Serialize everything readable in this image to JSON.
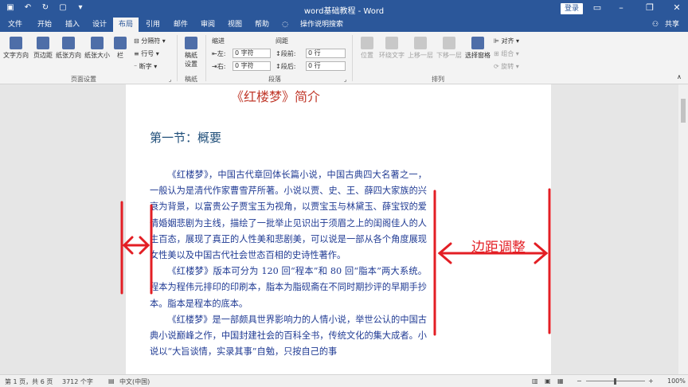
{
  "window": {
    "title": "word基础教程 - Word",
    "login_label": "登录"
  },
  "tabs": [
    {
      "label": "文件"
    },
    {
      "label": "开始"
    },
    {
      "label": "插入"
    },
    {
      "label": "设计"
    },
    {
      "label": "布局"
    },
    {
      "label": "引用"
    },
    {
      "label": "邮件"
    },
    {
      "label": "审阅"
    },
    {
      "label": "视图"
    },
    {
      "label": "帮助"
    },
    {
      "label": "操作说明搜索"
    }
  ],
  "share_label": "共享",
  "ribbon": {
    "page_setup": {
      "group_label": "页面设置",
      "text_direction": "文字方向",
      "margins": "页边距",
      "orientation": "纸张方向",
      "size": "纸张大小",
      "columns": "栏",
      "breaks": "分隔符",
      "line_numbers": "行号",
      "hyphenation": "断字"
    },
    "draft": {
      "group_label": "稿纸",
      "draft_setup": "稿纸\n设置"
    },
    "paragraph": {
      "group_label": "段落",
      "indent_label": "缩进",
      "spacing_label": "间距",
      "left_label": "左:",
      "left_value": "0 字符",
      "right_label": "右:",
      "right_value": "0 字符",
      "before_label": "段前:",
      "before_value": "0 行",
      "after_label": "段后:",
      "after_value": "0 行"
    },
    "arrange": {
      "group_label": "排列",
      "position": "位置",
      "wrap_text": "环绕文字",
      "bring_forward": "上移一层",
      "send_backward": "下移一层",
      "selection_pane": "选择窗格",
      "align": "对齐",
      "group": "组合",
      "rotate": "旋转"
    }
  },
  "document": {
    "title": "《红楼梦》简介",
    "section_heading": "第一节：概要",
    "paragraphs": [
      "《红楼梦》，中国古代章回体长篇小说，中国古典四大名著之一，一般认为是清代作家曹雪芹所著。小说以贾、史、王、薛四大家族的兴衰为背景，以富贵公子贾宝玉为视角，以贾宝玉与林黛玉、薛宝钗的爱情婚姻悲剧为主线，描绘了一批举止见识出于须眉之上的闺阁佳人的人生百态，展现了真正的人性美和悲剧美，可以说是一部从各个角度展现女性美以及中国古代社会世态百相的史诗性著作。",
      "《红楼梦》版本可分为 120 回“程本”和 80 回“脂本”两大系统。程本为程伟元排印的印刷本，脂本为脂砚斋在不同时期抄评的早期手抄本。脂本是程本的底本。",
      "《红楼梦》是一部颇具世界影响力的人情小说，举世公认的中国古典小说巅峰之作，中国封建社会的百科全书，传统文化的集大成者。小说以“大旨谈情，实录其事”自勉，只按自己的事"
    ]
  },
  "annotation": {
    "label": "边距调整",
    "color": "#e31e24"
  },
  "status": {
    "page": "第 1 页，共 6 页",
    "words": "3712 个字",
    "lang": "中文(中国)",
    "zoom": "100%"
  }
}
